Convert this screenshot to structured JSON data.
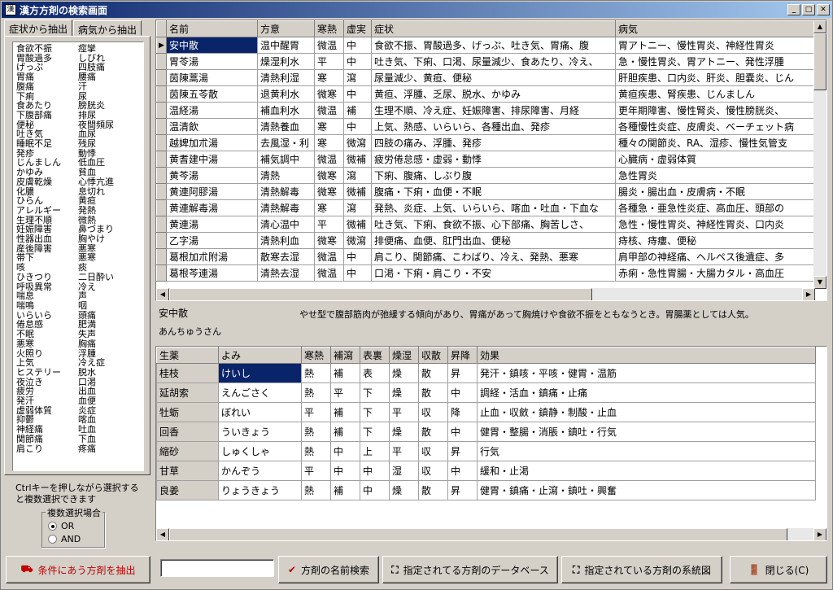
{
  "window": {
    "title": "漢方方剤の検索画面",
    "icon": "app-icon"
  },
  "tabs": [
    "症状から抽出",
    "病気から抽出"
  ],
  "symptoms": [
    [
      "食欲不振",
      "痙攣"
    ],
    [
      "胃酸過多",
      "しびれ"
    ],
    [
      "げっぷ",
      "四肢痛"
    ],
    [
      "胃痛",
      "腰痛"
    ],
    [
      "腹痛",
      "汗"
    ],
    [
      "下痢",
      "尿"
    ],
    [
      "食あたり",
      "膀胱炎"
    ],
    [
      "下腹部痛",
      "排尿"
    ],
    [
      "便秘",
      "夜間頻尿"
    ],
    [
      "吐き気",
      "血尿"
    ],
    [
      "睡眠不足",
      "残尿"
    ],
    [
      "発疹",
      "動悸"
    ],
    [
      "じんましん",
      "低血圧"
    ],
    [
      "かゆみ",
      "貧血"
    ],
    [
      "皮膚乾燥",
      "心悸亢進"
    ],
    [
      "化膿",
      "息切れ"
    ],
    [
      "ひらん",
      "黄疸"
    ],
    [
      "アレルギー",
      "発熱"
    ],
    [
      "生理不順",
      "微熱"
    ],
    [
      "妊娠障害",
      "鼻づまり"
    ],
    [
      "性器出血",
      "胸やけ"
    ],
    [
      "産後障害",
      "悪寒"
    ],
    [
      "帯下",
      "悪寒"
    ],
    [
      "咳",
      "痰"
    ],
    [
      "ひきつり",
      "二日酔い"
    ],
    [
      "呼吸異常",
      "冷え"
    ],
    [
      "喘息",
      "声"
    ],
    [
      "喘鳴",
      "咽"
    ],
    [
      "いらいら",
      "頭痛"
    ],
    [
      "倦怠感",
      "肥満"
    ],
    [
      "不眠",
      "失声"
    ],
    [
      "悪寒",
      "胸痛"
    ],
    [
      "火照り",
      "浮腫"
    ],
    [
      "上気",
      "冷え症"
    ],
    [
      "ヒステリー",
      "脱水"
    ],
    [
      "夜泣き",
      "口渇"
    ],
    [
      "疲労",
      "出血"
    ],
    [
      "発汗",
      "血便"
    ],
    [
      "虚弱体質",
      "炎症"
    ],
    [
      "抑鬱",
      "喀血"
    ],
    [
      "神経痛",
      "吐血"
    ],
    [
      "関節痛",
      "下血"
    ],
    [
      "肩こり",
      "疼痛"
    ]
  ],
  "hint": "Ctrlキーを押しながら選択すると複数選択できます",
  "multi_select": {
    "legend": "複数選択場合",
    "options": [
      "OR",
      "AND"
    ],
    "selected": "OR"
  },
  "extract_button": "条件にあう方剤を抽出",
  "formula_table": {
    "columns": [
      "名前",
      "方意",
      "寒熱",
      "虚実",
      "症状",
      "病気"
    ],
    "rows": [
      [
        "安中散",
        "温中醒胃",
        "微温",
        "中",
        "食欲不振、胃酸過多、げっぷ、吐き気、胃痛、腹",
        "胃アトニー、慢性胃炎、神経性胃炎"
      ],
      [
        "胃苓湯",
        "燥湿利水",
        "平",
        "中",
        "吐き気、下痢、口渇、尿量減少、食あたり、冷え、",
        "急・慢性胃炎、胃アトニー、発性浮腫"
      ],
      [
        "茵陳蒿湯",
        "清熱利湿",
        "寒",
        "瀉",
        "尿量減少、黄疸、便秘",
        "肝胆疾患、口内炎、肝炎、胆嚢炎、じん"
      ],
      [
        "茵陳五苓散",
        "退黄利水",
        "微寒",
        "中",
        "黄疸、浮腫、乏尿、脱水、かゆみ",
        "黄疸疾患、腎疾患、じんましん"
      ],
      [
        "温経湯",
        "補血利水",
        "微温",
        "補",
        "生理不順、冷え症、妊娠障害、排尿障害、月経",
        "更年期障害、慢性腎炎、慢性膀胱炎、"
      ],
      [
        "温清飲",
        "清熱養血",
        "寒",
        "中",
        "上気、熱感、いらいら、各種出血、発疹",
        "各種慢性炎症、皮膚炎、ベーチェット病"
      ],
      [
        "越婢加朮湯",
        "去風湿・利",
        "寒",
        "微瀉",
        "四肢の痛み、浮腫、発疹",
        "種々の関節炎、RA、湿疹、慢性気管支"
      ],
      [
        "黄耆建中湯",
        "補気調中",
        "微温",
        "微補",
        "疲労倦怠感・虚弱・動悸",
        "心臓病・虚弱体質"
      ],
      [
        "黄芩湯",
        "清熱",
        "微寒",
        "瀉",
        "下痢、腹痛、しぶり腹",
        "急性胃炎"
      ],
      [
        "黄連阿膠湯",
        "清熱解毒",
        "微寒",
        "微補",
        "腹痛・下痢・血便・不眠",
        "腸炎・腸出血・皮膚病・不眠"
      ],
      [
        "黄連解毒湯",
        "清熱解毒",
        "寒",
        "瀉",
        "発熱、炎症、上気、いらいら、喀血・吐血・下血な",
        "各種急・亜急性炎症、高血圧、頭部の"
      ],
      [
        "黄連湯",
        "清心温中",
        "平",
        "微補",
        "吐き気、下痢、食欲不振、心下部痛、胸苦しさ、",
        "急性・慢性胃炎、神経性胃炎、口内炎"
      ],
      [
        "乙字湯",
        "清熱利血",
        "微寒",
        "微瀉",
        "排便痛、血便、肛門出血、便秘",
        "痔核、痔瘻、便秘"
      ],
      [
        "葛根加朮附湯",
        "散寒去湿",
        "微温",
        "中",
        "肩こり、関節痛、こわばり、冷え、発熱、悪寒",
        "肩甲部の神経痛、ヘルペス後遺症、多"
      ],
      [
        "葛根芩連湯",
        "清熱去湿",
        "微温",
        "中",
        "口渇・下痢・肩こり・不安",
        "赤痢・急性胃腸・大腸カタル・高血圧"
      ]
    ]
  },
  "selected_formula": {
    "name": "安中散",
    "reading": "あんちゅうさん",
    "description": "やせ型で腹部筋肉が弛緩する傾向があり、胃痛があって胸焼けや食欲不振をともなうとき。胃腸薬としては人気。"
  },
  "herb_table": {
    "columns": [
      "生薬",
      "よみ",
      "寒熱",
      "補瀉",
      "表裏",
      "燥湿",
      "収散",
      "昇降",
      "効果"
    ],
    "rows": [
      [
        "桂枝",
        "けいし",
        "熱",
        "補",
        "表",
        "燥",
        "散",
        "昇",
        "発汗・鎮咳・平咳・健胃・温筋"
      ],
      [
        "延胡索",
        "えんごさく",
        "熱",
        "平",
        "下",
        "燥",
        "散",
        "中",
        "調経・活血・鎮痛・止痛"
      ],
      [
        "牡蛎",
        "ぼれい",
        "平",
        "補",
        "下",
        "平",
        "収",
        "降",
        "止血・収斂・鎮静・制酸・止血"
      ],
      [
        "回香",
        "ういきょう",
        "熱",
        "補",
        "下",
        "燥",
        "散",
        "中",
        "健胃・整腸・消脹・鎮吐・行気"
      ],
      [
        "縮砂",
        "しゅくしゃ",
        "熱",
        "中",
        "上",
        "平",
        "収",
        "昇",
        "行気"
      ],
      [
        "甘草",
        "かんぞう",
        "平",
        "中",
        "中",
        "湿",
        "収",
        "中",
        "緩和・止渇"
      ],
      [
        "良姜",
        "りょうきょう",
        "熱",
        "補",
        "中",
        "燥",
        "散",
        "昇",
        "健胃・鎮痛・止瀉・鎮吐・興奮"
      ]
    ]
  },
  "bottom": {
    "search_value": "",
    "name_search": "方剤の名前検索",
    "database": "指定されてる方剤のデータベース",
    "lineage": "指定されている方剤の系統図",
    "close": "閉じる(C)"
  }
}
